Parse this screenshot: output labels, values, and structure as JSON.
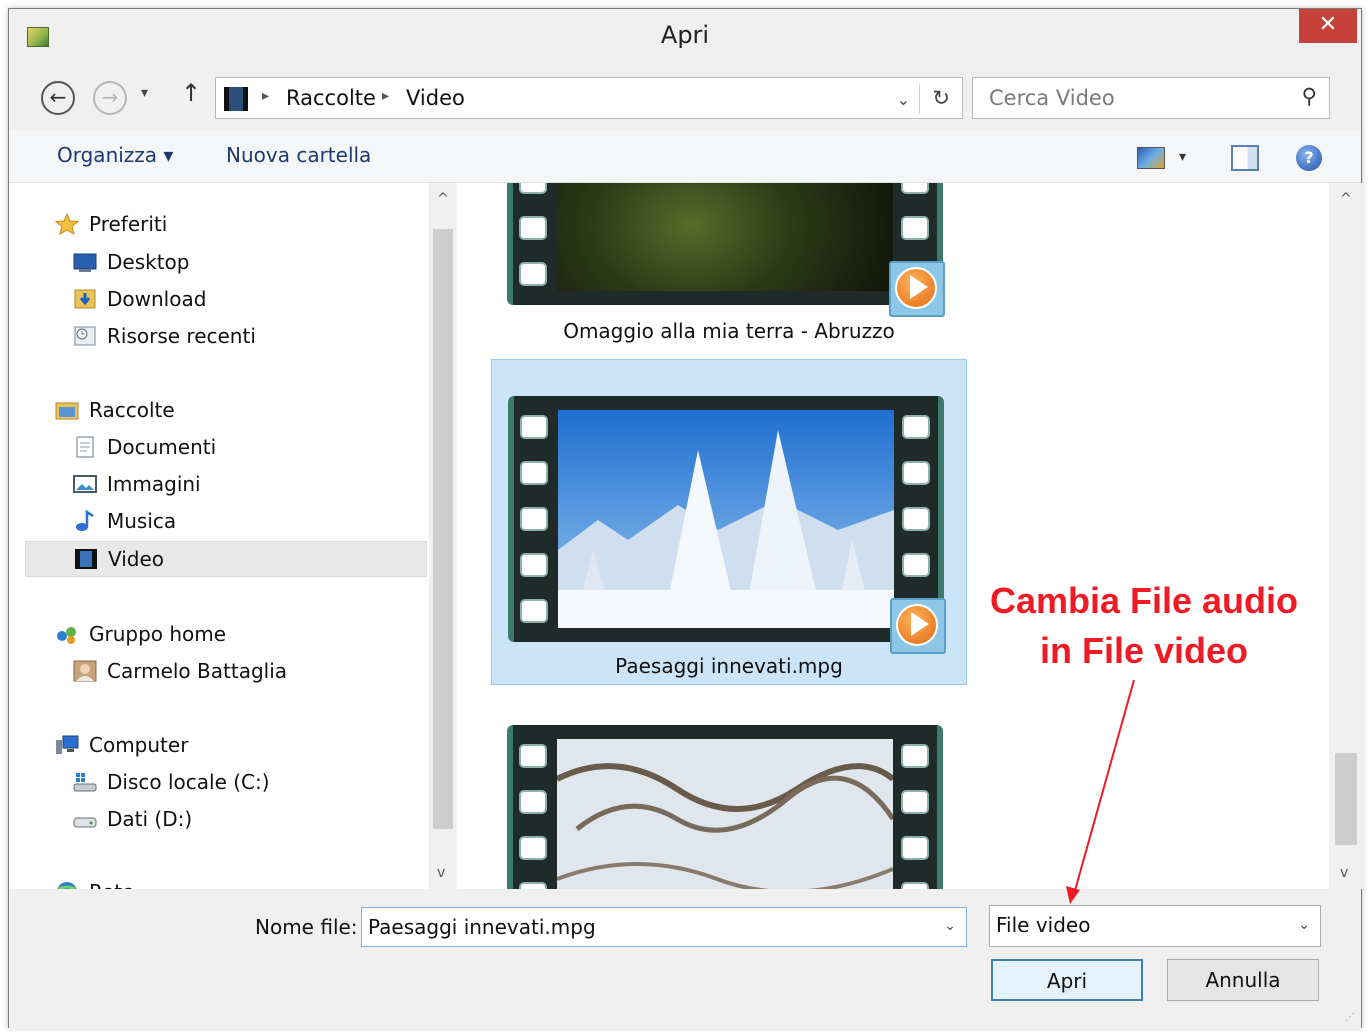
{
  "window": {
    "title": "Apri",
    "close_symbol": "✕"
  },
  "nav": {
    "back_symbol": "←",
    "forward_symbol": "→",
    "dropdown_symbol": "▾",
    "up_symbol": "↑",
    "breadcrumb": [
      "Raccolte",
      "Video"
    ],
    "breadcrumb_sep": "▸",
    "address_dropdown_symbol": "⌄",
    "refresh_symbol": "↻",
    "search_placeholder": "Cerca Video",
    "search_icon_symbol": "⚲"
  },
  "toolbar": {
    "organize_label": "Organizza ▾",
    "new_folder_label": "Nuova cartella",
    "view_dropdown_symbol": "▾",
    "help_symbol": "?"
  },
  "sidebar": {
    "items": [
      {
        "label": "Preferiti",
        "icon": "star-icon"
      },
      {
        "label": "Desktop",
        "icon": "desktop-icon"
      },
      {
        "label": "Download",
        "icon": "download-icon"
      },
      {
        "label": "Risorse recenti",
        "icon": "recent-places-icon"
      },
      {
        "label": "Raccolte",
        "icon": "libraries-icon"
      },
      {
        "label": "Documenti",
        "icon": "documents-icon"
      },
      {
        "label": "Immagini",
        "icon": "pictures-icon"
      },
      {
        "label": "Musica",
        "icon": "music-icon"
      },
      {
        "label": "Video",
        "icon": "video-icon",
        "selected": true
      },
      {
        "label": "Gruppo home",
        "icon": "homegroup-icon"
      },
      {
        "label": "Carmelo Battaglia",
        "icon": "user-avatar-icon"
      },
      {
        "label": "Computer",
        "icon": "computer-icon"
      },
      {
        "label": "Disco locale (C:)",
        "icon": "local-disk-icon"
      },
      {
        "label": "Dati (D:)",
        "icon": "drive-icon"
      },
      {
        "label": "Rete",
        "icon": "network-icon"
      }
    ],
    "scroll_up_symbol": "^",
    "scroll_down_symbol": "v"
  },
  "files": {
    "items": [
      {
        "name": "Omaggio alla mia terra - Abruzzo",
        "thumbnail": "forest-night"
      },
      {
        "name": "Paesaggi innevati.mpg",
        "thumbnail": "snowy-trees",
        "selected": true
      },
      {
        "name": "",
        "thumbnail": "snowy-branches"
      }
    ],
    "scroll_up_symbol": "^",
    "scroll_down_symbol": "v"
  },
  "bottom": {
    "filename_label": "Nome file:",
    "filename_value": "Paesaggi innevati.mpg",
    "dropdown_symbol": "⌄",
    "filetype_value": "File video",
    "open_label": "Apri",
    "cancel_label": "Annulla",
    "grip_symbol": "⋰"
  },
  "annotation": {
    "line1": "Cambia File audio",
    "line2": "in File video",
    "color": "#ee1b24"
  },
  "colors": {
    "selection": "#cce4f7",
    "close": "#c7413b",
    "link": "#1e3a6e"
  }
}
